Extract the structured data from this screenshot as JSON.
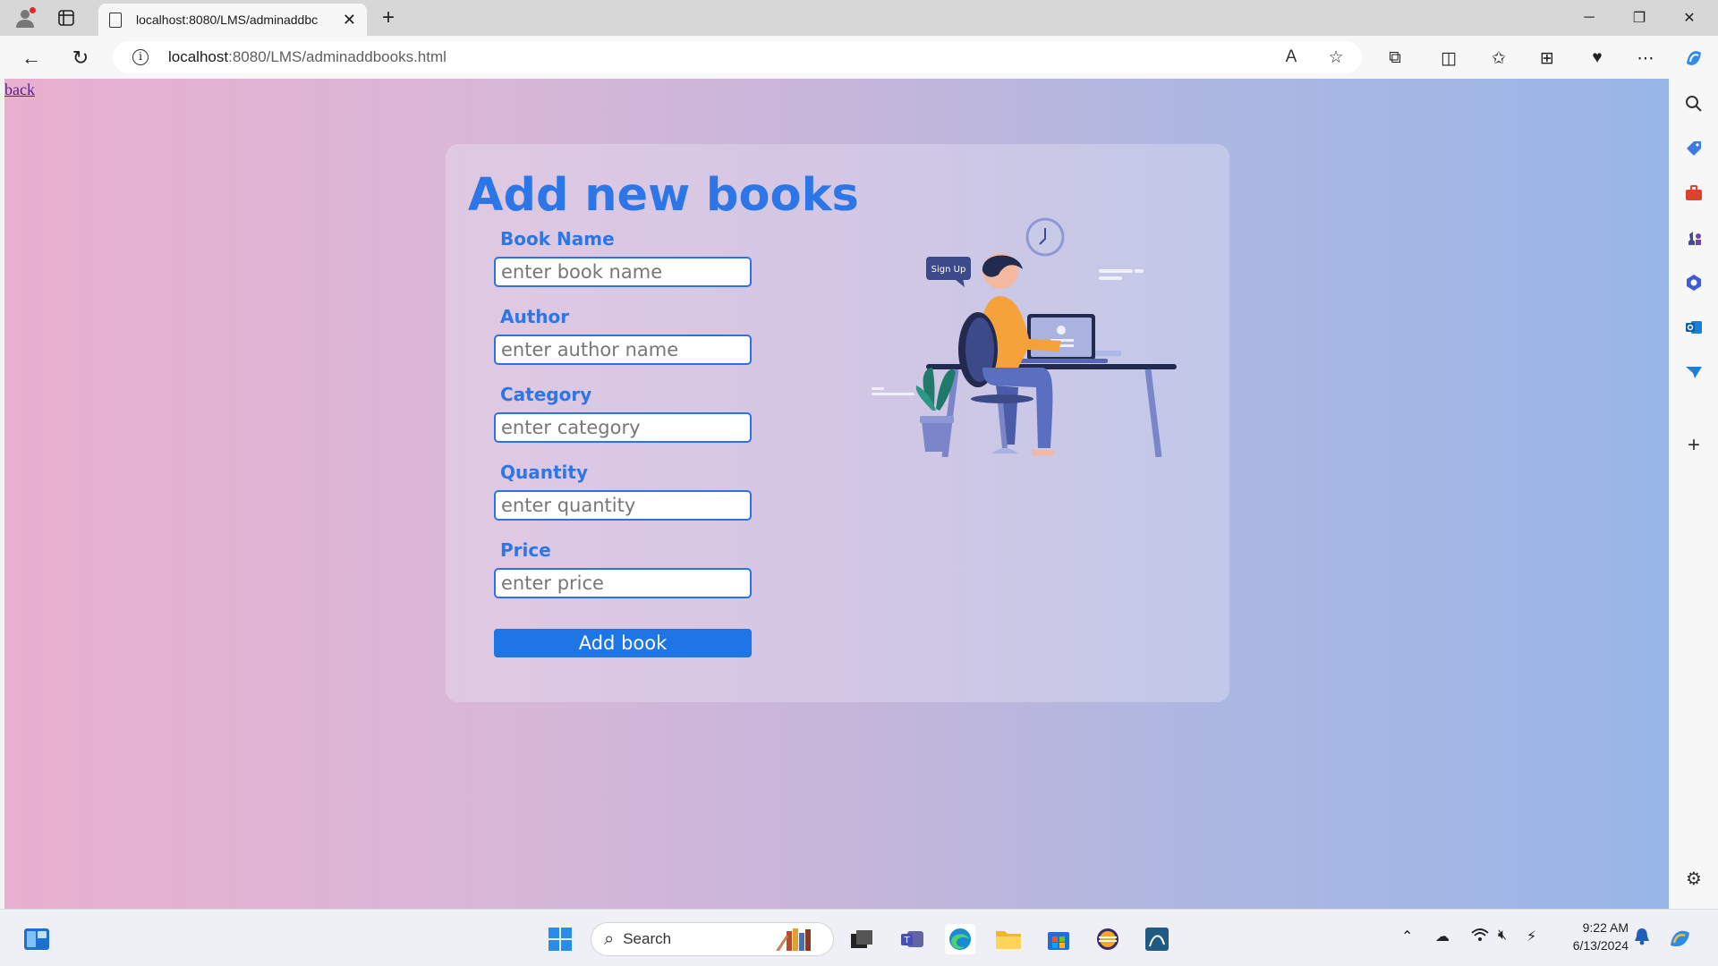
{
  "browser": {
    "tab_title": "localhost:8080/LMS/adminaddbc",
    "url_host": "localhost",
    "url_path": ":8080/LMS/adminaddbooks.html"
  },
  "page": {
    "back_link": "back",
    "heading": "Add new books",
    "fields": [
      {
        "label": "Book Name",
        "placeholder": "enter book name"
      },
      {
        "label": "Author",
        "placeholder": "enter author name"
      },
      {
        "label": "Category",
        "placeholder": "enter category"
      },
      {
        "label": "Quantity",
        "placeholder": "enter quantity"
      },
      {
        "label": "Price",
        "placeholder": "enter price"
      }
    ],
    "submit_label": "Add book",
    "illustration_bubble": "Sign Up"
  },
  "taskbar": {
    "search_label": "Search",
    "time": "9:22 AM",
    "date": "6/13/2024"
  },
  "colors": {
    "accent": "#2d76e8",
    "button": "#1e75e6",
    "gradient_left": "#e9b0cf",
    "gradient_right": "#98b6e8"
  }
}
